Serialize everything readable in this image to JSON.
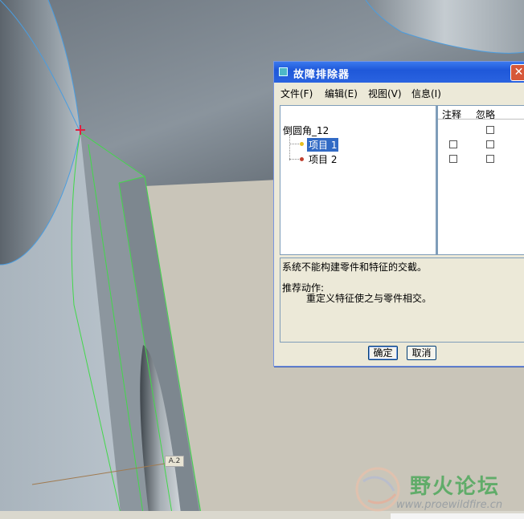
{
  "dialog": {
    "title": "故障排除器",
    "close_glyph": "✕",
    "menu": [
      "文件(F)",
      "编辑(E)",
      "视图(V)",
      "信息(I)"
    ],
    "columns": [
      "注释",
      "忽略"
    ],
    "tree": {
      "root": "倒圆角_12",
      "items": [
        {
          "label": "项目 1",
          "selected": true,
          "bullet_color": "#e8c020"
        },
        {
          "label": "项目 2",
          "selected": false,
          "bullet_color": "#c04030"
        }
      ]
    },
    "message": {
      "line1": "系统不能构建零件和特征的交截。",
      "line2": "推荐动作:",
      "line3": "重定义特征使之与零件相交。"
    },
    "ok_label": "确定",
    "cancel_label": "取消"
  },
  "viewport": {
    "dimension_tag": "A.2"
  },
  "watermark": {
    "cn": "野火论坛",
    "url": "www.proewildfire.cn"
  }
}
